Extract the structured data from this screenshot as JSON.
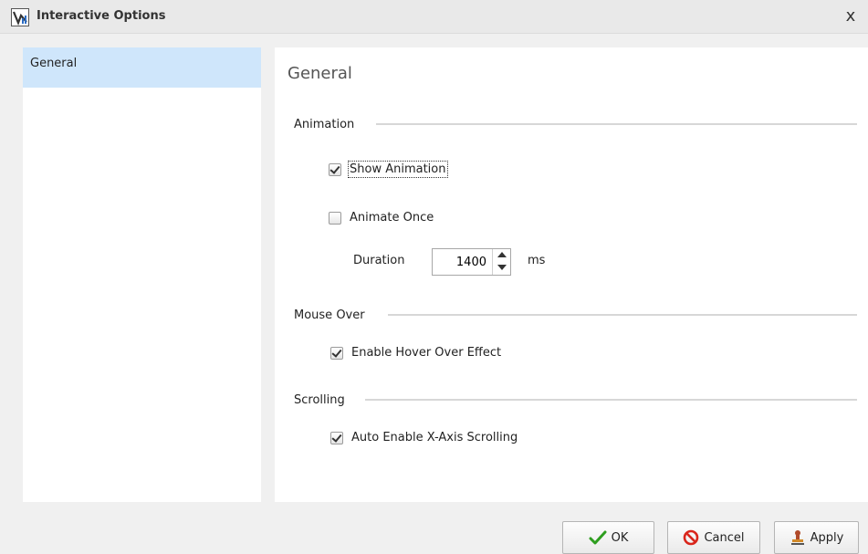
{
  "window": {
    "title": "Interactive Options",
    "close_glyph": "x"
  },
  "sidebar": {
    "items": [
      {
        "label": "General",
        "selected": true
      }
    ]
  },
  "panel": {
    "title": "General",
    "animation": {
      "title": "Animation",
      "show_animation": {
        "label": "Show Animation",
        "checked": true
      },
      "animate_once": {
        "label": "Animate Once",
        "checked": false
      },
      "duration": {
        "label": "Duration",
        "value": "1400",
        "unit": "ms"
      }
    },
    "mouse_over": {
      "title": "Mouse Over",
      "hover_effect": {
        "label": "Enable Hover Over Effect",
        "checked": true
      }
    },
    "scrolling": {
      "title": "Scrolling",
      "auto_scroll": {
        "label": "Auto Enable X-Axis Scrolling",
        "checked": true
      }
    }
  },
  "buttons": {
    "ok": "OK",
    "cancel": "Cancel",
    "apply": "Apply"
  },
  "icons": {
    "app": "chart-app-icon",
    "close": "close-icon",
    "ok": "checkmark-icon",
    "cancel": "no-entry-icon",
    "apply": "stamp-icon"
  },
  "colors": {
    "selection": "#cfe6fb",
    "ok_check": "#2e9e1f",
    "cancel_red": "#d9261c"
  }
}
